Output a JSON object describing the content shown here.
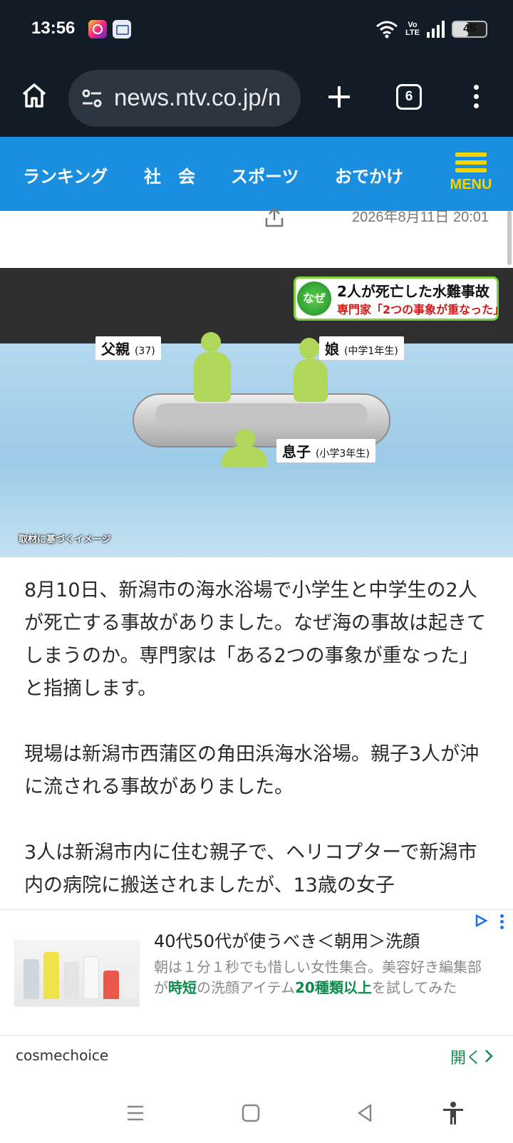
{
  "status": {
    "time": "13:56",
    "volte_line1": "Vo",
    "volte_line2": "LTE",
    "battery_level": 45,
    "battery_text": "45",
    "notification_icons": [
      "instagram-icon",
      "message-icon"
    ]
  },
  "browser": {
    "url": "news.ntv.co.jp/n",
    "tab_count": "6",
    "icons": [
      "home-icon",
      "site-settings-icon",
      "new-tab-icon",
      "tabs-icon",
      "more-icon"
    ]
  },
  "nav": {
    "items": [
      "ランキング",
      "社　会",
      "スポーツ",
      "おでかけ"
    ],
    "menu_label": "MENU"
  },
  "meta": {
    "date": "2026年8月11日 20:01"
  },
  "photo": {
    "caption_badge": "なぜ",
    "caption_line1": "2人が死亡した水難事故",
    "caption_line2": "専門家「2つの事象が重なった」",
    "label_father": "父親",
    "label_father_detail": "(37)",
    "label_daughter": "娘",
    "label_daughter_detail": "(中学1年生)",
    "label_son": "息子",
    "label_son_detail": "(小学3年生)",
    "credit": "取材に基づくイメージ"
  },
  "article": {
    "paragraphs": [
      "8月10日、新潟市の海水浴場で小学生と中学生の2人が死亡する事故がありました。なぜ海の事故は起きてしまうのか。専門家は「ある2つの事象が重なった」と指摘します。",
      "現場は新潟市西蒲区の角田浜海水浴場。親子3人が沖に流される事故がありました。",
      "3人は新潟市内に住む親子で、ヘリコプターで新潟市内の病院に搬送されましたが、13歳の女子"
    ]
  },
  "ad": {
    "title": "40代50代が使うべき＜朝用＞洗顔",
    "desc_part1": "朝は１分１秒でも惜しい女性集合。美容好き編集部が",
    "desc_highlight1": "時短",
    "desc_part2": "の洗顔アイテム",
    "desc_highlight2": "20種類以上",
    "desc_part3": "を試してみた",
    "source": "cosmechoice",
    "open_label": "開く",
    "colors": {
      "highlight": "#0f8a4a",
      "adchoices": "#1a73e8"
    }
  },
  "colors": {
    "status_bg": "#121c26",
    "nav_bg": "#1a8fe0",
    "menu_accent": "#f5d400",
    "caption_red": "#d21b1b",
    "caption_green": "#7bd23a"
  }
}
